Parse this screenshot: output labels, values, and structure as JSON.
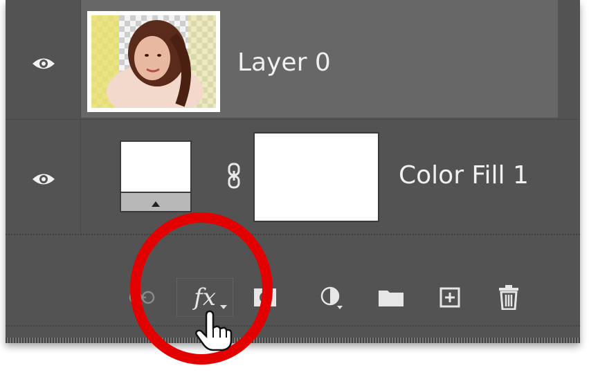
{
  "layers": [
    {
      "name": "Layer 0",
      "visible": true,
      "selected": true
    },
    {
      "name": "Color Fill 1",
      "visible": true,
      "selected": false
    }
  ],
  "toolbar": {
    "fx_label": "fx",
    "icons": [
      "link-layers-icon",
      "add-layer-style-icon",
      "add-mask-icon",
      "adjustment-layer-icon",
      "new-group-icon",
      "new-layer-icon",
      "delete-layer-icon"
    ]
  },
  "colors": {
    "panel_bg": "#535353",
    "selected_row_bg": "#676767",
    "highlight_circle": "#e30000"
  }
}
